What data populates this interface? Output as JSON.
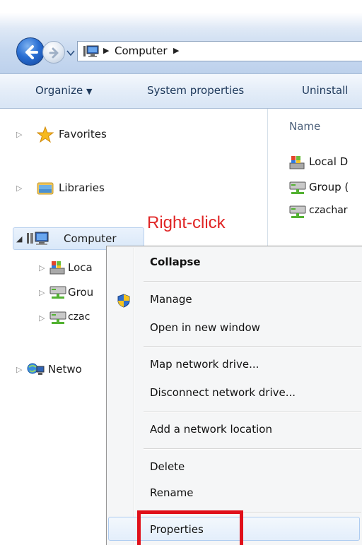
{
  "address": {
    "segments": [
      "Computer"
    ]
  },
  "toolbar": {
    "organize": "Organize",
    "system_properties": "System properties",
    "uninstall": "Uninstall"
  },
  "nav": {
    "favorites": "Favorites",
    "libraries": "Libraries",
    "computer": "Computer",
    "children": [
      "Loca",
      "Grou",
      "czac"
    ],
    "network": "Netwo"
  },
  "content": {
    "name_header": "Name",
    "items": [
      "Local D",
      "Group (",
      "czachar"
    ]
  },
  "annotation": "Right-click",
  "context_menu": {
    "collapse": "Collapse",
    "manage": "Manage",
    "open_new_window": "Open in new window",
    "map_network_drive": "Map network drive...",
    "disconnect_network_drive": "Disconnect network drive...",
    "add_network_location": "Add a network location",
    "delete": "Delete",
    "rename": "Rename",
    "properties": "Properties"
  },
  "colors": {
    "annotation_red": "#e02525",
    "highlight_box": "#e0101a",
    "accent_blue": "#2a6fd3"
  }
}
